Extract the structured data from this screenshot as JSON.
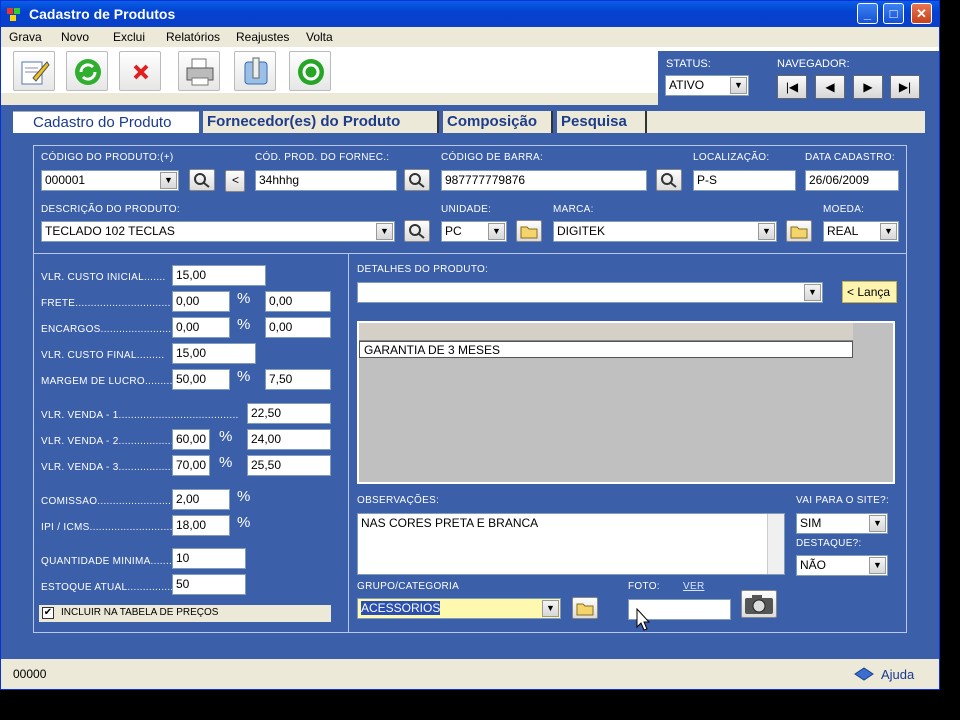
{
  "window": {
    "title": "Cadastro de Produtos"
  },
  "menu": [
    "Grava",
    "Novo",
    "Exclui",
    "Relatórios",
    "Reajustes",
    "Volta"
  ],
  "header": {
    "status_label": "STATUS:",
    "status_value": "ATIVO",
    "nav_label": "NAVEGADOR:"
  },
  "tabs": [
    "Cadastro do Produto",
    "Fornecedor(es) do Produto",
    "Composição",
    "Pesquisa"
  ],
  "top": {
    "codigo_label": "CÓDIGO DO PRODUTO:(+)",
    "codigo_value": "000001",
    "cod_fornec_label": "CÓD. PROD. DO FORNEC.:",
    "cod_fornec_value": "34hhhg",
    "barra_label": "CÓDIGO DE BARRA:",
    "barra_value": "987777779876",
    "local_label": "LOCALIZAÇÃO:",
    "local_value": "P-S",
    "data_label": "DATA CADASTRO:",
    "data_value": "26/06/2009",
    "descricao_label": "DESCRIÇÃO DO PRODUTO:",
    "descricao_value": "TECLADO 102 TECLAS",
    "unidade_label": "UNIDADE:",
    "unidade_value": "PC",
    "marca_label": "MARCA:",
    "marca_value": "DIGITEK",
    "moeda_label": "MOEDA:",
    "moeda_value": "REAL"
  },
  "prices": {
    "custo_inicial_label": "VLR. CUSTO INICIAL.......",
    "custo_inicial": "15,00",
    "frete_label": "FRETE...............................",
    "frete": "0,00",
    "frete_pct": "0,00",
    "encargos_label": "ENCARGOS.........................",
    "encargos": "0,00",
    "encargos_pct": "0,00",
    "custo_final_label": "VLR. CUSTO FINAL.........",
    "custo_final": "15,00",
    "margem_label": "MARGEM DE LUCRO..........",
    "margem": "50,00",
    "margem_pct": "7,50",
    "venda1_label": "VLR. VENDA  - 1.......................................",
    "venda1": "22,50",
    "venda2_label": "VLR. VENDA  - 2.........................",
    "venda2_pct": "60,00",
    "venda2": "24,00",
    "venda3_label": "VLR. VENDA  - 3.........................",
    "venda3_pct": "70,00",
    "venda3": "25,50",
    "comissao_label": "COMISSÃO.........................",
    "comissao": "2,00",
    "ipi_label": "IPI / ICMS............................",
    "ipi": "18,00",
    "qtd_min_label": "QUANTIDADE MÍNIMA.........",
    "qtd_min": "10",
    "estoque_label": "ESTOQUE ATUAL...............",
    "estoque": "50",
    "percent": "%",
    "incluir_label": "INCLUIR NA TABELA DE PREÇOS"
  },
  "details": {
    "detalhes_label": "DETALHES DO PRODUTO:",
    "lanca_label": "< Lança",
    "grid_rows": [
      "GARANTIA DE 3 MESES"
    ],
    "obs_label": "OBSERVAÇÕES:",
    "obs_value": "NAS CORES PRETA E BRANCA",
    "site_label": "VAI PARA O SITE?:",
    "site_value": "SIM",
    "destaque_label": "DESTAQUE?:",
    "destaque_value": "NÃO",
    "grupo_label": "GRUPO/CATEGORIA",
    "grupo_value": "ACESSORIOS",
    "foto_label": "FOTO:",
    "ver_label": "VER"
  },
  "statusbar": {
    "code": "00000",
    "help": "Ajuda"
  }
}
